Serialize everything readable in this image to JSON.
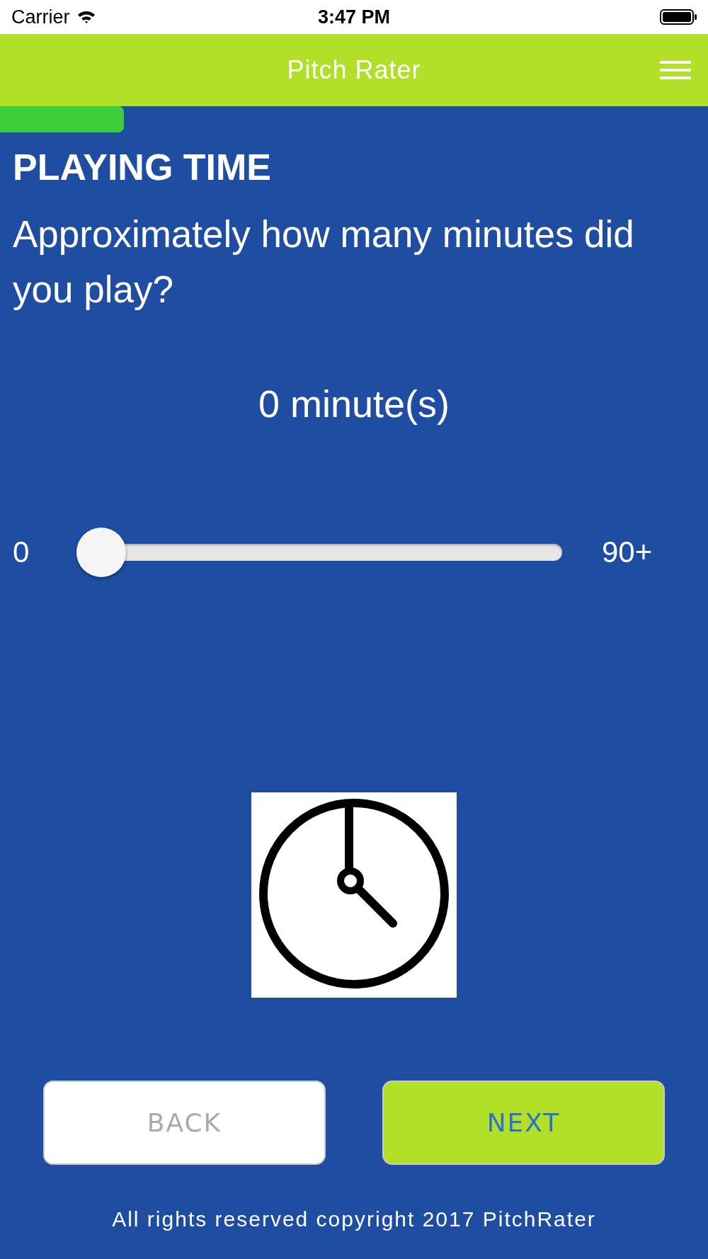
{
  "status_bar": {
    "carrier": "Carrier",
    "time": "3:47 PM"
  },
  "header": {
    "title": "Pitch Rater"
  },
  "question": {
    "heading": "PLAYING TIME",
    "text": "Approximately how many minutes did you play?"
  },
  "value_label": "0 minute(s)",
  "slider": {
    "min_label": "0",
    "max_label": "90+",
    "level": 0
  },
  "buttons": [
    {
      "label": "BACK",
      "kind": "secondary"
    },
    {
      "label": "NEXT",
      "kind": "primary"
    }
  ],
  "footer": "All rights reserved copyright 2017 PitchRater"
}
